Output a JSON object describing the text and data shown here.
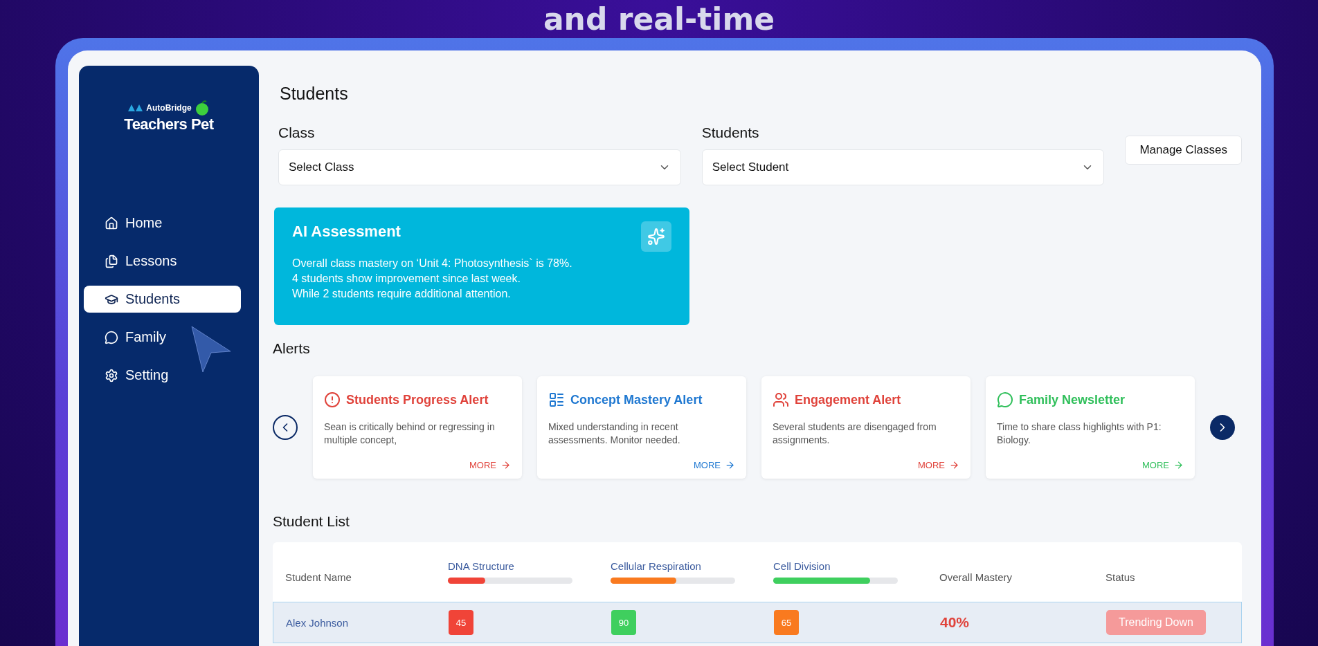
{
  "headline": "and real-time",
  "sidebar": {
    "logo": {
      "brand": "AutoBridge",
      "product": "Teachers Pet"
    },
    "items": [
      {
        "label": "Home",
        "kind": "home",
        "selected": false
      },
      {
        "label": "Lessons",
        "kind": "lessons",
        "selected": false
      },
      {
        "label": "Students",
        "kind": "students",
        "selected": true
      },
      {
        "label": "Family",
        "kind": "family",
        "selected": false
      },
      {
        "label": "Setting",
        "kind": "setting",
        "selected": false
      }
    ]
  },
  "page": {
    "title": "Students"
  },
  "filters": [
    {
      "label": "Class",
      "placeholder": "Select Class"
    },
    {
      "label": "Students",
      "placeholder": "Select Student"
    }
  ],
  "manage_button": "Manage Classes",
  "ai_card": {
    "title": "AI Assessment",
    "lines": [
      "Overall class mastery on ‘Unit 4: Photosynthesis` is 78%.",
      "4 students show improvement since last week.",
      "While 2 students require additional attention."
    ]
  },
  "alerts": {
    "title": "Alerts",
    "items": [
      {
        "kind": "progress",
        "title": "Students Progress Alert",
        "body": "Sean is critically behind or regressing in multiple concept,",
        "more": "MORE",
        "color": "#e0433b"
      },
      {
        "kind": "concept",
        "title": "Concept Mastery Alert",
        "body": "Mixed understanding in recent assessments. Monitor needed.",
        "more": "MORE",
        "color": "#1f78d1"
      },
      {
        "kind": "engagement",
        "title": "Engagement Alert",
        "body": "Several students are disengaged from assignments.",
        "more": "MORE",
        "color": "#e0433b"
      },
      {
        "kind": "family",
        "title": "Family Newsletter",
        "body": "Time to share class highlights with P1: Biology.",
        "more": "MORE",
        "color": "#2fbf5a"
      }
    ]
  },
  "student_list": {
    "title": "Student List",
    "columns": [
      {
        "kind": "text",
        "label": "Student Name"
      },
      {
        "kind": "skill",
        "label": "DNA Structure",
        "level": 0.3,
        "color": "#f04438"
      },
      {
        "kind": "skill",
        "label": "Cellular Respiration",
        "level": 0.53,
        "color": "#f97a1f"
      },
      {
        "kind": "skill",
        "label": "Cell Division",
        "level": 0.78,
        "color": "#3fcf5e"
      },
      {
        "kind": "text",
        "label": "Overall Mastery"
      },
      {
        "kind": "text",
        "label": "Status"
      }
    ],
    "rows": [
      {
        "name": "Alex Johnson",
        "selected": true,
        "scores": [
          {
            "value": "45",
            "color": "#f04438"
          },
          {
            "value": "90",
            "color": "#3fcf5e"
          },
          {
            "value": "65",
            "color": "#f97a1f"
          }
        ],
        "overall": "40%",
        "status": "Trending Down"
      }
    ]
  }
}
